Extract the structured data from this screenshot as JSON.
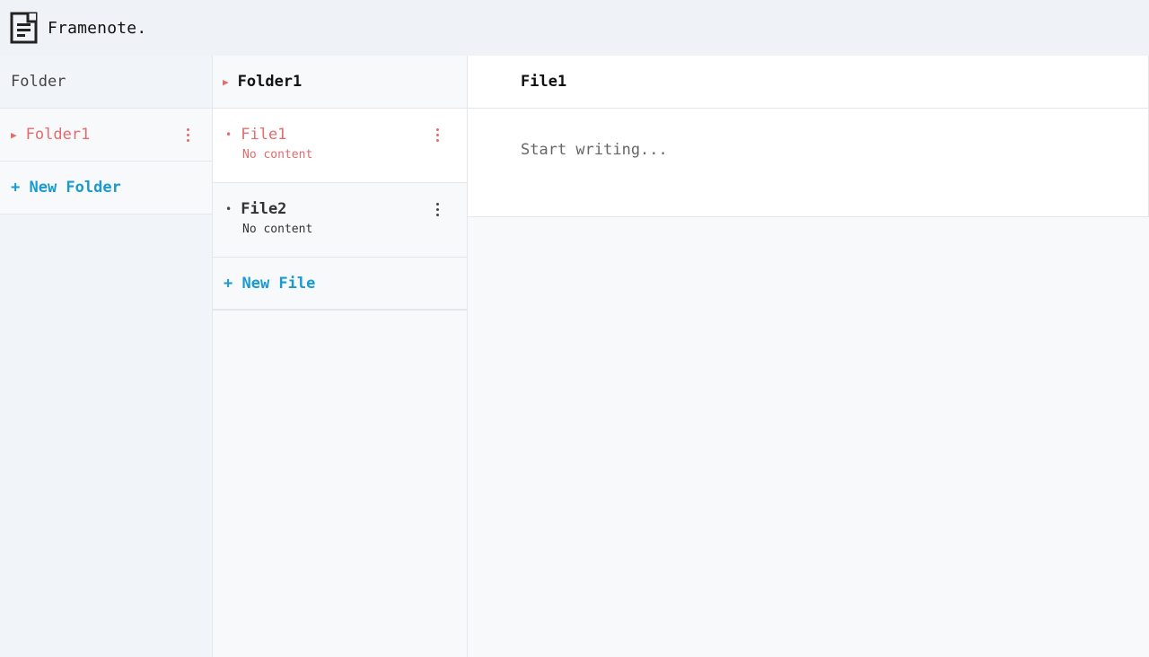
{
  "app": {
    "title": "Framenote.",
    "logo_icon": "document-icon"
  },
  "folders": {
    "header": "Folder",
    "items": [
      {
        "label": "Folder1",
        "icon": "triangle-right-icon",
        "menu_icon": "kebab-menu-icon",
        "selected": true
      }
    ],
    "new_label": "+ New Folder"
  },
  "files": {
    "header": "Folder1",
    "header_icon": "triangle-right-icon",
    "items": [
      {
        "label": "File1",
        "preview": "No content",
        "selected": true,
        "menu_icon": "kebab-menu-icon"
      },
      {
        "label": "File2",
        "preview": "No content",
        "selected": false,
        "menu_icon": "kebab-menu-icon"
      }
    ],
    "new_label": "+ New File"
  },
  "editor": {
    "title": "File1",
    "placeholder": "Start writing..."
  },
  "colors": {
    "accent_red": "#e36b6b",
    "accent_blue": "#1a9ad0"
  }
}
